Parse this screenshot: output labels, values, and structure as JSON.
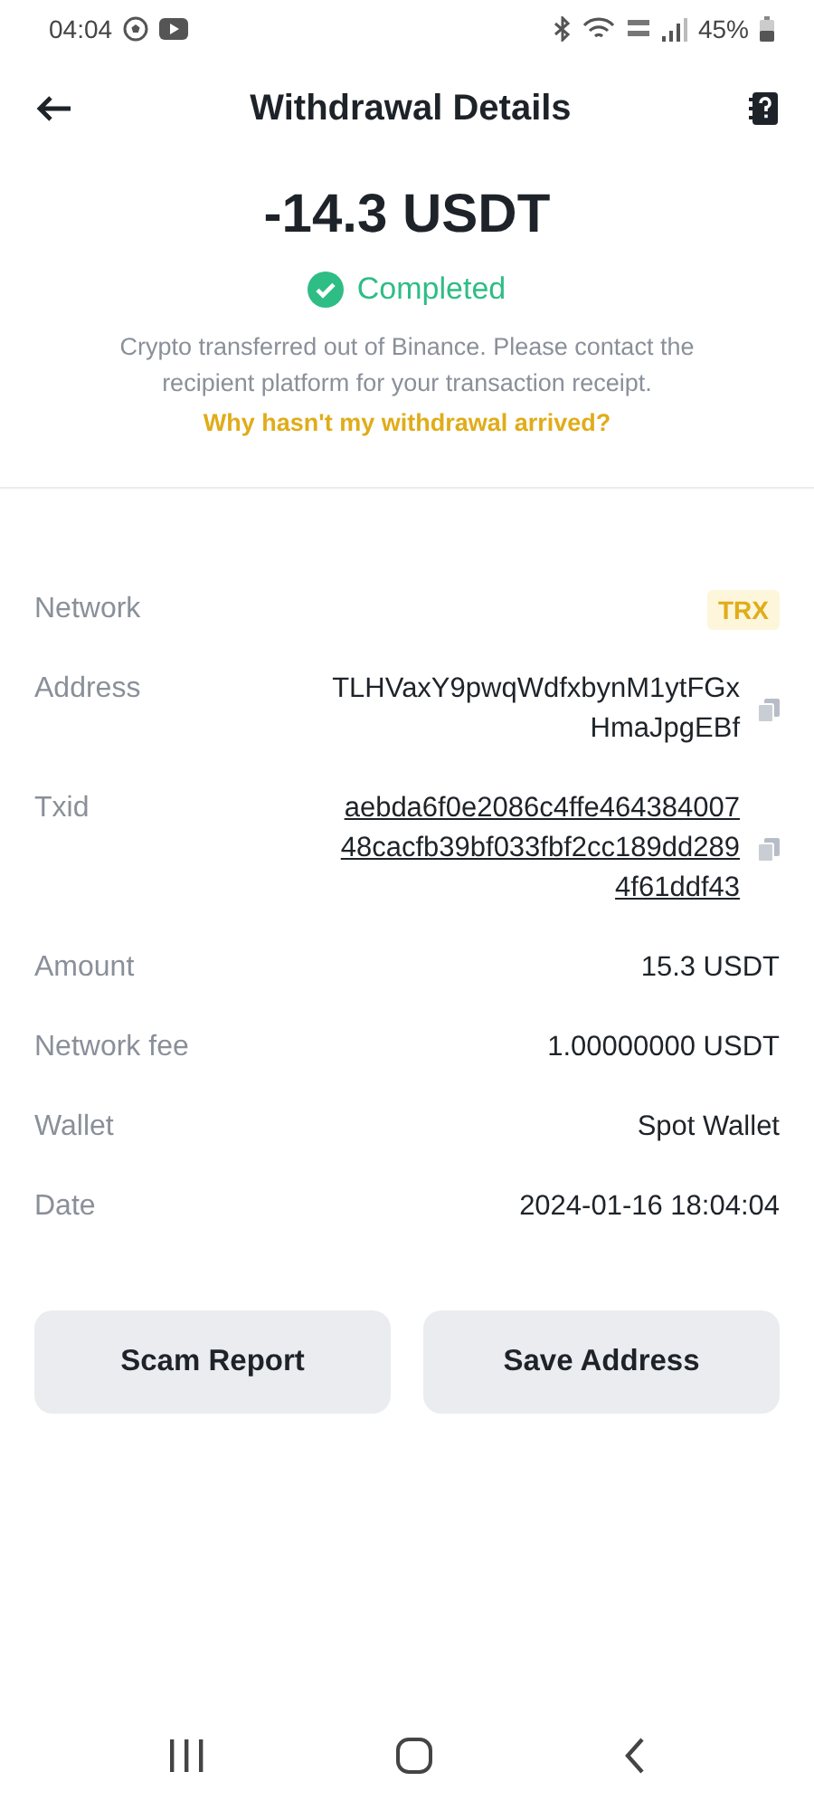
{
  "status_bar": {
    "time": "04:04",
    "battery": "45%"
  },
  "header": {
    "title": "Withdrawal Details"
  },
  "summary": {
    "amount": "-14.3 USDT",
    "status": "Completed",
    "note": "Crypto transferred out of Binance. Please contact the recipient platform for your transaction receipt.",
    "help_link": "Why hasn't my withdrawal arrived?"
  },
  "details": [
    {
      "kind": "tag",
      "label": "Network",
      "lines": [
        "TRX"
      ]
    },
    {
      "kind": "copy",
      "label": "Address",
      "lines": [
        "TLHVaxY9pwqWdfxbynM1ytFGx",
        "HmaJpgEBf"
      ]
    },
    {
      "kind": "link",
      "label": "Txid",
      "lines": [
        "aebda6f0e2086c4ffe464384007",
        "48cacfb39bf033fbf2cc189dd289",
        "4f61ddf43"
      ]
    },
    {
      "kind": "plain",
      "label": "Amount",
      "lines": [
        "15.3 USDT"
      ]
    },
    {
      "kind": "plain",
      "label": "Network fee",
      "lines": [
        "1.00000000 USDT"
      ]
    },
    {
      "kind": "plain",
      "label": "Wallet",
      "lines": [
        "Spot Wallet"
      ]
    },
    {
      "kind": "plain",
      "label": "Date",
      "lines": [
        "2024-01-16 18:04:04"
      ]
    }
  ],
  "buttons": [
    "Scam Report",
    "Save Address"
  ]
}
